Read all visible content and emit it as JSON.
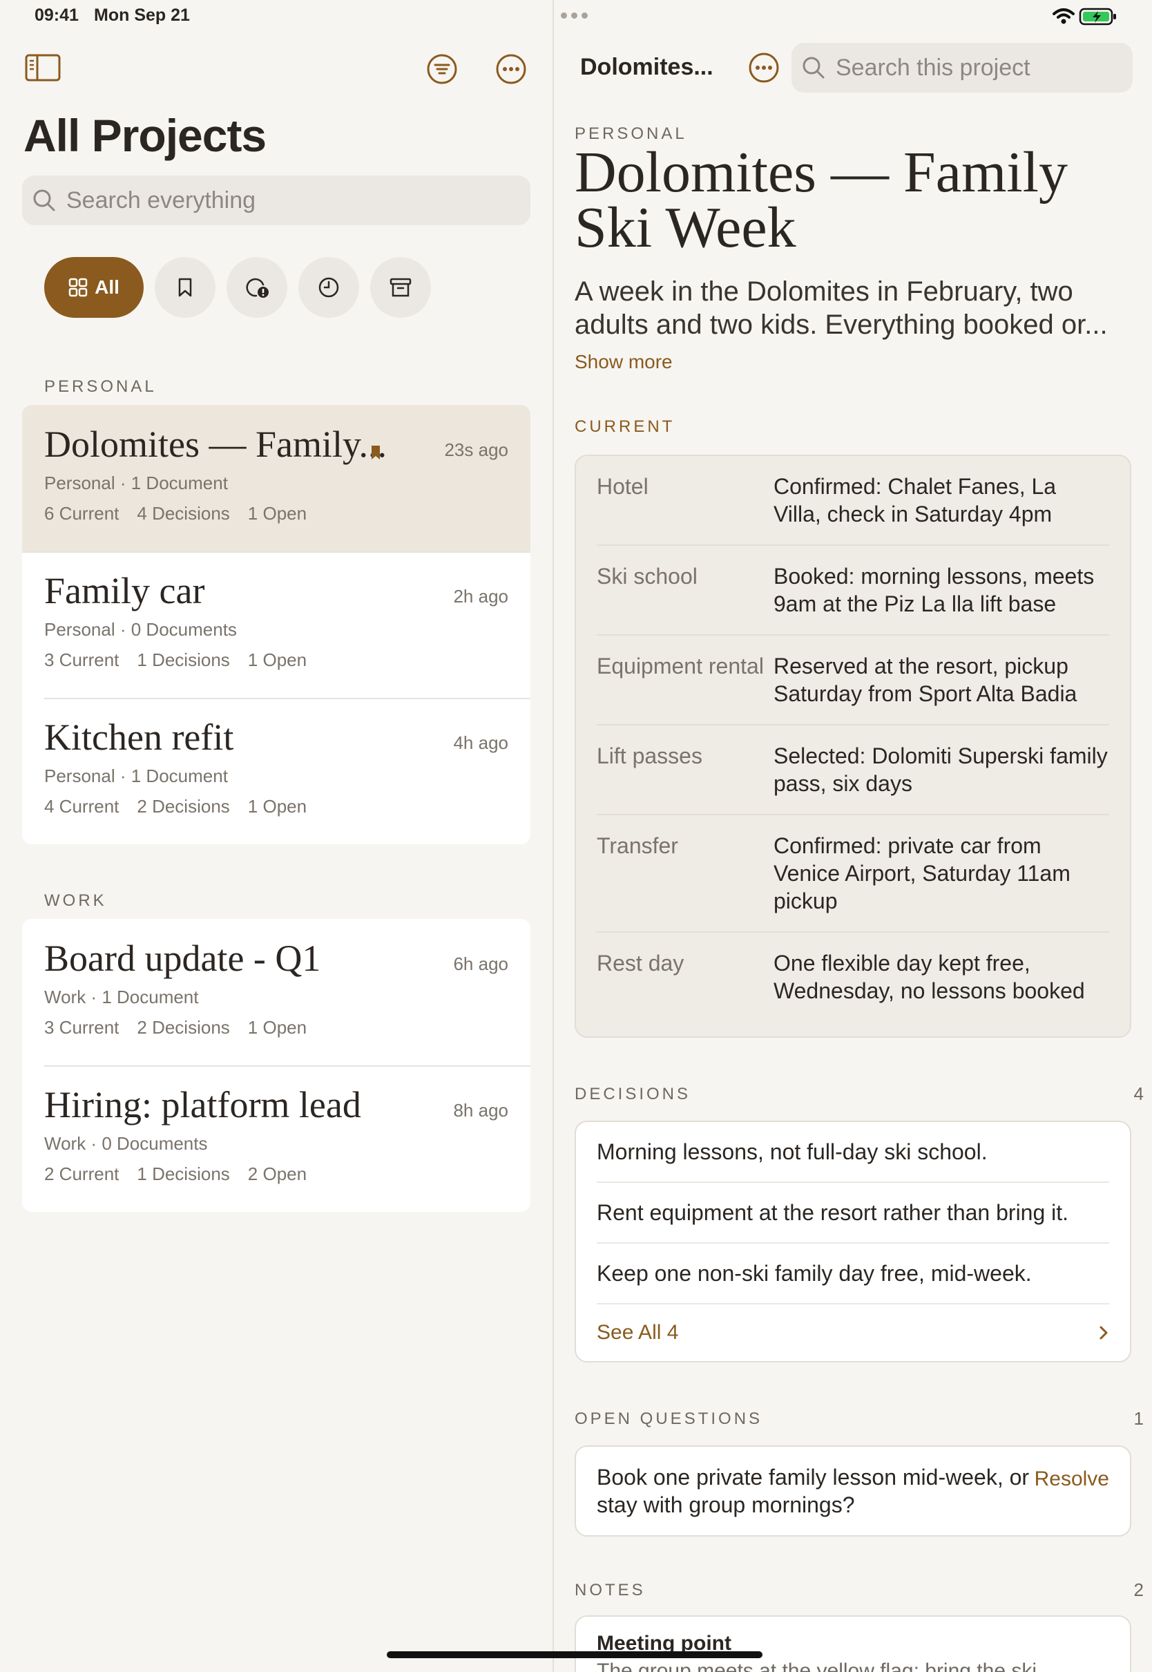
{
  "status_bar": {
    "time": "09:41",
    "date": "Mon Sep 21"
  },
  "sidebar": {
    "title": "All Projects",
    "search_placeholder": "Search everything",
    "filters": {
      "all_label": "All"
    },
    "sections": [
      {
        "label": "PERSONAL",
        "projects": [
          {
            "title": "Dolomites — Family...",
            "time": "23s ago",
            "area": "Personal",
            "documents": "1 Document",
            "current": "6 Current",
            "decisions": "4 Decisions",
            "open": "1 Open",
            "bookmarked": true,
            "selected": true
          },
          {
            "title": "Family car",
            "time": "2h ago",
            "area": "Personal",
            "documents": "0 Documents",
            "current": "3 Current",
            "decisions": "1 Decisions",
            "open": "1 Open"
          },
          {
            "title": "Kitchen refit",
            "time": "4h ago",
            "area": "Personal",
            "documents": "1 Document",
            "current": "4 Current",
            "decisions": "2 Decisions",
            "open": "1 Open"
          }
        ]
      },
      {
        "label": "WORK",
        "projects": [
          {
            "title": "Board update - Q1",
            "time": "6h ago",
            "area": "Work",
            "documents": "1 Document",
            "current": "3 Current",
            "decisions": "2 Decisions",
            "open": "1 Open"
          },
          {
            "title": "Hiring: platform lead",
            "time": "8h ago",
            "area": "Work",
            "documents": "0 Documents",
            "current": "2 Current",
            "decisions": "1 Decisions",
            "open": "2 Open"
          }
        ]
      }
    ]
  },
  "detail": {
    "nav_title": "Dolomites...",
    "search_placeholder": "Search this project",
    "category": "PERSONAL",
    "title": "Dolomites — Family Ski Week",
    "description": "A week in the Dolomites in February, two adults and two kids. Everything booked or...",
    "show_more": "Show more",
    "current_label": "CURRENT",
    "current": [
      {
        "key": "Hotel",
        "value": "Confirmed: Chalet Fanes, La Villa, check in Saturday 4pm"
      },
      {
        "key": "Ski school",
        "value": "Booked: morning lessons, meets 9am at the Piz La lla lift base"
      },
      {
        "key": "Equipment rental",
        "value": "Reserved at the resort, pickup Saturday from Sport Alta Badia"
      },
      {
        "key": "Lift passes",
        "value": "Selected: Dolomiti Superski family pass, six days"
      },
      {
        "key": "Transfer",
        "value": "Confirmed: private car from Venice Airport, Saturday 11am pickup"
      },
      {
        "key": "Rest day",
        "value": "One flexible day kept free, Wednesday, no lessons booked"
      }
    ],
    "decisions_label": "DECISIONS",
    "decisions_count": "4",
    "decisions": [
      "Morning lessons, not full-day ski school.",
      "Rent equipment at the resort rather than bring it.",
      "Keep one non-ski family day free, mid-week."
    ],
    "see_all": "See All 4",
    "open_questions_label": "OPEN QUESTIONS",
    "open_questions_count": "1",
    "open_questions": [
      {
        "text": "Book one private family lesson mid-week, or stay with group mornings?",
        "action": "Resolve"
      }
    ],
    "notes_label": "NOTES",
    "notes_count": "2",
    "notes": [
      {
        "title": "Meeting point",
        "body": "The group meets at the yellow flag; bring the ski"
      }
    ]
  },
  "colors": {
    "accent": "#8a5a1f",
    "background": "#f7f5f1",
    "selected_row": "#ede6dd",
    "battery": "#34c759"
  },
  "icons": [
    "sidebar-toggle-icon",
    "filter-icon",
    "more-icon",
    "search-icon",
    "grid-icon",
    "bookmark-icon",
    "alert-circle-icon",
    "clock-icon",
    "archive-icon",
    "chevron-right-icon",
    "wifi-icon",
    "battery-icon"
  ]
}
